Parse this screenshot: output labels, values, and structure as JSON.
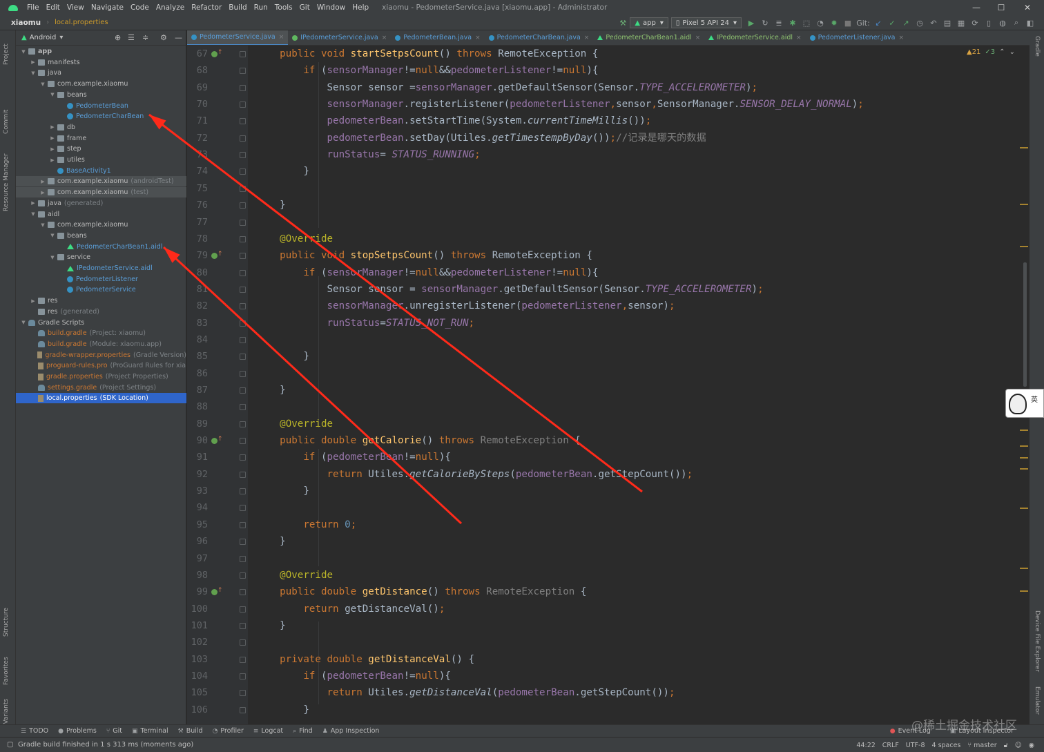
{
  "menubar": {
    "items": [
      "File",
      "Edit",
      "View",
      "Navigate",
      "Code",
      "Analyze",
      "Refactor",
      "Build",
      "Run",
      "Tools",
      "Git",
      "Window",
      "Help"
    ],
    "window_title": "xiaomu - PedometerService.java [xiaomu.app] - Administrator",
    "minimize": "—",
    "maximize": "☐",
    "close": "✕"
  },
  "toolbar": {
    "project": "xiaomu",
    "file": "local.properties",
    "run_config": "app",
    "device": "Pixel 5 API 24",
    "git_label": "Git:"
  },
  "left_strip": [
    "Project",
    "Commit",
    "Resource Manager",
    "Structure",
    "Favorites",
    "Build Variants"
  ],
  "right_strip": [
    "Gradle",
    "Device File Explorer",
    "Emulator"
  ],
  "project_panel": {
    "view": "Android",
    "tree": [
      {
        "label": "app",
        "depth": 0,
        "arrow": "▼",
        "icon": "folder",
        "bold": true
      },
      {
        "label": "manifests",
        "depth": 1,
        "arrow": "▶",
        "icon": "folder"
      },
      {
        "label": "java",
        "depth": 1,
        "arrow": "▼",
        "icon": "folder"
      },
      {
        "label": "com.example.xiaomu",
        "depth": 2,
        "arrow": "▼",
        "icon": "folder"
      },
      {
        "label": "beans",
        "depth": 3,
        "arrow": "▼",
        "icon": "folder"
      },
      {
        "label": "PedometerBean",
        "depth": 4,
        "arrow": "",
        "icon": "class",
        "color": "blue"
      },
      {
        "label": "PedometerCharBean",
        "depth": 4,
        "arrow": "",
        "icon": "class",
        "color": "blue"
      },
      {
        "label": "db",
        "depth": 3,
        "arrow": "▶",
        "icon": "folder"
      },
      {
        "label": "frame",
        "depth": 3,
        "arrow": "▶",
        "icon": "folder"
      },
      {
        "label": "step",
        "depth": 3,
        "arrow": "▶",
        "icon": "folder"
      },
      {
        "label": "utiles",
        "depth": 3,
        "arrow": "▶",
        "icon": "folder"
      },
      {
        "label": "BaseActivity1",
        "depth": 3,
        "arrow": "",
        "icon": "class",
        "color": "blue"
      },
      {
        "label": "com.example.xiaomu",
        "mod": "(androidTest)",
        "depth": 2,
        "arrow": "▶",
        "icon": "folder",
        "hl": true
      },
      {
        "label": "com.example.xiaomu",
        "mod": "(test)",
        "depth": 2,
        "arrow": "▶",
        "icon": "folder",
        "hl": true
      },
      {
        "label": "java",
        "mod": "(generated)",
        "depth": 1,
        "arrow": "▶",
        "icon": "folder"
      },
      {
        "label": "aidl",
        "depth": 1,
        "arrow": "▼",
        "icon": "folder"
      },
      {
        "label": "com.example.xiaomu",
        "depth": 2,
        "arrow": "▼",
        "icon": "folder"
      },
      {
        "label": "beans",
        "depth": 3,
        "arrow": "▼",
        "icon": "folder"
      },
      {
        "label": "PedometerCharBean1.aidl",
        "depth": 4,
        "arrow": "",
        "icon": "aidl",
        "color": "blue"
      },
      {
        "label": "service",
        "depth": 3,
        "arrow": "▼",
        "icon": "folder"
      },
      {
        "label": "IPedometerService.aidl",
        "depth": 4,
        "arrow": "",
        "icon": "aidl",
        "color": "blue"
      },
      {
        "label": "PedometerListener",
        "depth": 4,
        "arrow": "",
        "icon": "class",
        "color": "blue"
      },
      {
        "label": "PedometerService",
        "depth": 4,
        "arrow": "",
        "icon": "class",
        "color": "blue"
      },
      {
        "label": "res",
        "depth": 1,
        "arrow": "▶",
        "icon": "folder"
      },
      {
        "label": "res",
        "mod": "(generated)",
        "depth": 1,
        "arrow": "",
        "icon": "folder"
      },
      {
        "label": "Gradle Scripts",
        "depth": 0,
        "arrow": "▼",
        "icon": "gradle"
      },
      {
        "label": "build.gradle",
        "mod": "(Project: xiaomu)",
        "depth": 1,
        "arrow": "",
        "icon": "gradle",
        "color": "orange"
      },
      {
        "label": "build.gradle",
        "mod": "(Module: xiaomu.app)",
        "depth": 1,
        "arrow": "",
        "icon": "gradle",
        "color": "orange"
      },
      {
        "label": "gradle-wrapper.properties",
        "mod": "(Gradle Version)",
        "depth": 1,
        "arrow": "",
        "icon": "props",
        "color": "orange"
      },
      {
        "label": "proguard-rules.pro",
        "mod": "(ProGuard Rules for xia",
        "depth": 1,
        "arrow": "",
        "icon": "props",
        "color": "orange"
      },
      {
        "label": "gradle.properties",
        "mod": "(Project Properties)",
        "depth": 1,
        "arrow": "",
        "icon": "props",
        "color": "orange"
      },
      {
        "label": "settings.gradle",
        "mod": "(Project Settings)",
        "depth": 1,
        "arrow": "",
        "icon": "gradle",
        "color": "orange"
      },
      {
        "label": "local.properties",
        "mod": "(SDK Location)",
        "depth": 1,
        "arrow": "",
        "icon": "props",
        "selected": true
      }
    ]
  },
  "tabs": [
    {
      "label": "PedometerService.java",
      "icon": "class",
      "active": true
    },
    {
      "label": "IPedometerService.java",
      "icon": "interface"
    },
    {
      "label": "PedometerBean.java",
      "icon": "class"
    },
    {
      "label": "PedometerCharBean.java",
      "icon": "class"
    },
    {
      "label": "PedometerCharBean1.aidl",
      "icon": "aidl"
    },
    {
      "label": "IPedometerService.aidl",
      "icon": "aidl"
    },
    {
      "label": "PedometerListener.java",
      "icon": "class"
    }
  ],
  "inspection": {
    "warnings": "▲21",
    "ok": "✓3"
  },
  "code_lines": [
    {
      "n": 67,
      "mark": true,
      "html": "    <span class='kw'>public void </span><span class='fn'>startSetpsCount</span>() <span class='kw'>throws </span>RemoteException {"
    },
    {
      "n": 68,
      "html": "        <span class='kw'>if </span>(<span class='fld'>sensorManager</span>!=<span class='kw'>null</span>&amp;&amp;<span class='fld'>pedometerListener</span>!=<span class='kw'>null</span>){"
    },
    {
      "n": 69,
      "html": "            Sensor sensor =<span class='fld'>sensorManager</span>.getDefaultSensor(Sensor.<span class='cst'>TYPE_ACCELEROMETER</span>)<span class='kw'>;</span>"
    },
    {
      "n": 70,
      "html": "            <span class='fld'>sensorManager</span>.registerListener(<span class='fld'>pedometerListener</span><span class='kw'>,</span>sensor<span class='kw'>,</span>SensorManager.<span class='cst'>SENSOR_DELAY_NORMAL</span>)<span class='kw'>;</span>"
    },
    {
      "n": 71,
      "html": "            <span class='fld'>pedometerBean</span>.setStartTime(System.<span class='stat'>currentTimeMillis</span>())<span class='kw'>;</span>"
    },
    {
      "n": 72,
      "html": "            <span class='fld'>pedometerBean</span>.setDay(Utiles.<span class='stat'>getTimestempByDay</span>())<span class='kw'>;</span><span class='cmt'>//记录是哪天的数据</span>"
    },
    {
      "n": 73,
      "html": "            <span class='fld'>runStatus</span>= <span class='cst'>STATUS_RUNNING</span><span class='kw'>;</span>"
    },
    {
      "n": 74,
      "html": "        }"
    },
    {
      "n": 75,
      "html": ""
    },
    {
      "n": 76,
      "html": "    }"
    },
    {
      "n": 77,
      "html": ""
    },
    {
      "n": 78,
      "html": "    <span class='ann'>@Override</span>"
    },
    {
      "n": 79,
      "mark": true,
      "html": "    <span class='kw'>public void </span><span class='fn'>stopSetpsCount</span>() <span class='kw'>throws </span>RemoteException {"
    },
    {
      "n": 80,
      "html": "        <span class='kw'>if </span>(<span class='fld'>sensorManager</span>!=<span class='kw'>null</span>&amp;&amp;<span class='fld'>pedometerListener</span>!=<span class='kw'>null</span>){"
    },
    {
      "n": 81,
      "html": "            Sensor sensor = <span class='fld'>sensorManager</span>.getDefaultSensor(Sensor.<span class='cst'>TYPE_ACCELEROMETER</span>)<span class='kw'>;</span>"
    },
    {
      "n": 82,
      "html": "            <span class='fld'>sensorManager</span>.unregisterListener(<span class='fld'>pedometerListener</span><span class='kw'>,</span>sensor)<span class='kw'>;</span>"
    },
    {
      "n": 83,
      "html": "            <span class='fld'>runStatus</span>=<span class='cst'>STATUS_NOT_RUN</span><span class='kw'>;</span>"
    },
    {
      "n": 84,
      "html": ""
    },
    {
      "n": 85,
      "html": "        }"
    },
    {
      "n": 86,
      "html": ""
    },
    {
      "n": 87,
      "html": "    }"
    },
    {
      "n": 88,
      "html": ""
    },
    {
      "n": 89,
      "html": "    <span class='ann'>@Override</span>"
    },
    {
      "n": 90,
      "mark": true,
      "html": "    <span class='kw'>public double </span><span class='fn'>getCalorie</span>() <span class='kw'>throws </span><span class='gray'>RemoteException</span> {"
    },
    {
      "n": 91,
      "html": "        <span class='kw'>if </span>(<span class='fld'>pedometerBean</span>!=<span class='kw'>null</span>){"
    },
    {
      "n": 92,
      "html": "            <span class='kw'>return </span>Utiles.<span class='stat'>getCalorieBySteps</span>(<span class='fld'>pedometerBean</span>.getStepCount())<span class='kw'>;</span>"
    },
    {
      "n": 93,
      "html": "        }"
    },
    {
      "n": 94,
      "html": ""
    },
    {
      "n": 95,
      "html": "        <span class='kw'>return </span><span class='num'>0</span><span class='kw'>;</span>"
    },
    {
      "n": 96,
      "html": "    }"
    },
    {
      "n": 97,
      "html": ""
    },
    {
      "n": 98,
      "html": "    <span class='ann'>@Override</span>"
    },
    {
      "n": 99,
      "mark": true,
      "html": "    <span class='kw'>public double </span><span class='fn'>getDistance</span>() <span class='kw'>throws </span><span class='gray'>RemoteException</span> {"
    },
    {
      "n": 100,
      "html": "        <span class='kw'>return </span>getDistanceVal()<span class='kw'>;</span>"
    },
    {
      "n": 101,
      "html": "    }"
    },
    {
      "n": 102,
      "html": ""
    },
    {
      "n": 103,
      "html": "    <span class='kw'>private double </span><span class='fn'>getDistanceVal</span>() {"
    },
    {
      "n": 104,
      "html": "        <span class='kw'>if </span>(<span class='fld'>pedometerBean</span>!=<span class='kw'>null</span>){"
    },
    {
      "n": 105,
      "html": "            <span class='kw'>return </span>Utiles.<span class='stat'>getDistanceVal</span>(<span class='fld'>pedometerBean</span>.getStepCount())<span class='kw'>;</span>"
    },
    {
      "n": 106,
      "html": "        }"
    }
  ],
  "bottom_tools": [
    {
      "icon": "☰",
      "label": "TODO"
    },
    {
      "icon": "●",
      "label": "Problems"
    },
    {
      "icon": "⑂",
      "label": "Git"
    },
    {
      "icon": "▣",
      "label": "Terminal"
    },
    {
      "icon": "⚒",
      "label": "Build"
    },
    {
      "icon": "◔",
      "label": "Profiler"
    },
    {
      "icon": "≡",
      "label": "Logcat"
    },
    {
      "icon": "⌕",
      "label": "Find"
    },
    {
      "icon": "♟",
      "label": "App Inspection"
    }
  ],
  "bottom_right_tools": [
    "Event Log",
    "Layout Inspector"
  ],
  "status": {
    "message": "Gradle build finished in 1 s 313 ms (moments ago)",
    "position": "44:22",
    "line_sep": "CRLF",
    "encoding": "UTF-8",
    "indent": "4 spaces",
    "branch": "master"
  },
  "watermark": "@稀土掘金技术社区",
  "sticker_text": "英",
  "annotation_color": "#ff2a1a"
}
